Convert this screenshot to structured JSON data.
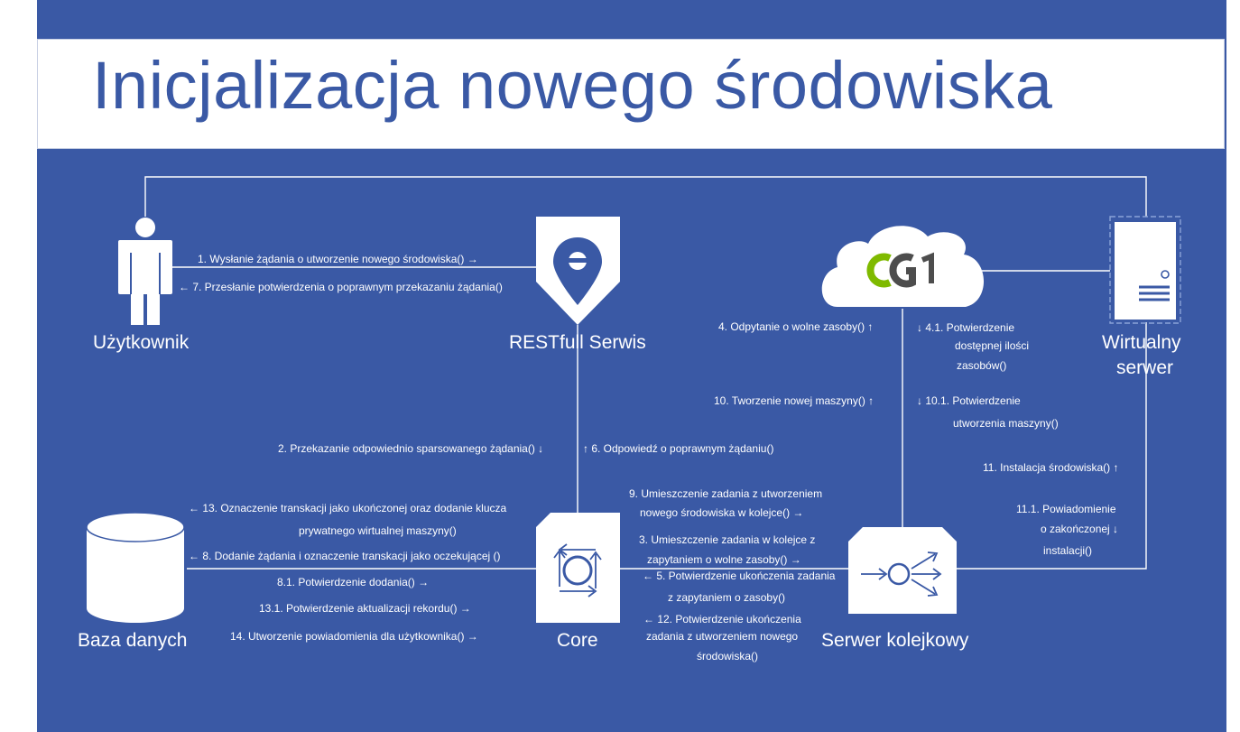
{
  "title": "Inicjalizacja nowego środowiska",
  "colors": {
    "background": "#3a59a5",
    "title_text": "#3a59a5",
    "lines": "#ffffff",
    "logo_gray": "#4d4d4d",
    "logo_green": "#7fba00"
  },
  "nodes": {
    "user": "Użytkownik",
    "rest": "RESTfull Serwis",
    "virtual_server_1": "Wirtualny",
    "virtual_server_2": "serwer",
    "database": "Baza danych",
    "core": "Core",
    "queue_server": "Serwer kolejkowy"
  },
  "messages": {
    "m1": "1. Wysłanie żądania o utworzenie nowego środowiska()  →",
    "m7": "←  7. Przesłanie potwierdzenia o poprawnym przekazaniu żądania()",
    "m4": "4. Odpytanie o wolne zasoby()  ↑",
    "m41a": "↓ 4.1. Potwierdzenie",
    "m41b": "dostępnej ilości",
    "m41c": "zasobów()",
    "m10": "10. Tworzenie nowej maszyny()  ↑",
    "m101a": "↓ 10.1. Potwierdzenie",
    "m101b": "utworzenia maszyny()",
    "m2": "2. Przekazanie odpowiednio sparsowanego żądania()  ↓",
    "m6": "↑  6. Odpowiedź o poprawnym żądaniu()",
    "m11": "11. Instalacja środowiska()  ↑",
    "m9a": "9. Umieszczenie zadania z utworzeniem",
    "m9b": "nowego środowiska w kolejce()  →",
    "m111a": "11.1. Powiadomienie",
    "m111b": "o zakończonej   ↓",
    "m111c": "instalacji()",
    "m13a": "←  13. Oznaczenie transkacji jako ukończonej oraz dodanie klucza",
    "m13b": "prywatnego wirtualnej maszyny()",
    "m8": "←  8. Dodanie żądania   i oznaczenie transkacji jako oczekującej  ()",
    "m3a": "3. Umieszczenie zadania w kolejce z",
    "m3b": "zapytaniem o wolne zasoby()  →",
    "m81": "8.1. Potwierdzenie dodania()  →",
    "m5a": "←  5. Potwierdzenie ukończenia zadania",
    "m5b": "z zapytaniem o zasoby()",
    "m131": "13.1. Potwierdzenie aktualizacji rekordu()  →",
    "m12a": "←  12. Potwierdzenie ukończenia",
    "m12b": "zadania z utworzeniem nowego",
    "m12c": "środowiska()",
    "m14": "14. Utworzenie powiadomienia dla użytkownika()  →"
  }
}
